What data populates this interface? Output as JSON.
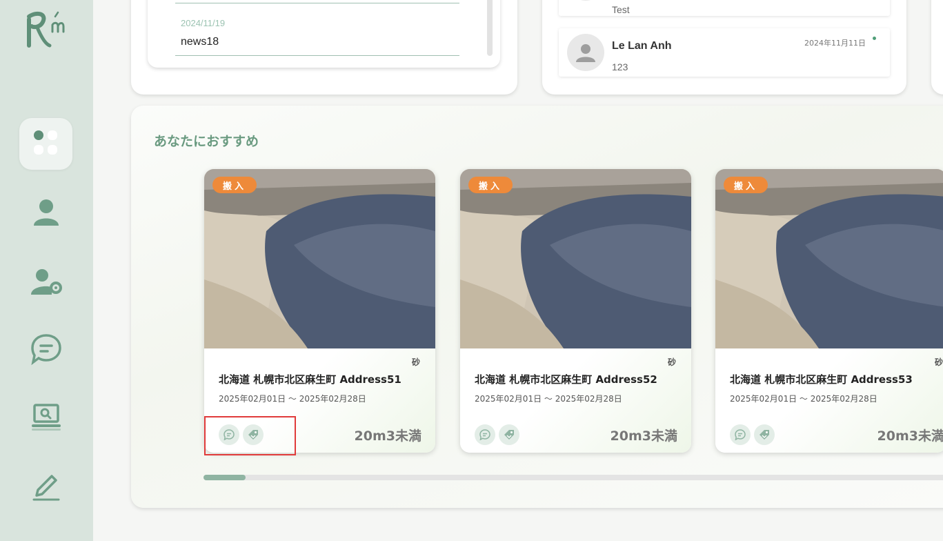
{
  "sidebar": {
    "logo": "logo-rm",
    "items": [
      {
        "name": "dashboard-icon",
        "active": true
      },
      {
        "name": "user-icon"
      },
      {
        "name": "user-settings-icon"
      },
      {
        "name": "chat-icon"
      },
      {
        "name": "laptop-search-icon"
      },
      {
        "name": "pencil-icon"
      }
    ]
  },
  "news": {
    "date": "2024/11/19",
    "title": "news18"
  },
  "messages": [
    {
      "name": "",
      "text": "Test",
      "date": ""
    },
    {
      "name": "Le Lan Anh",
      "text": "123",
      "date": "2024年11月11日",
      "unread": true
    }
  ],
  "recommend": {
    "title": "あなたにおすすめ",
    "cards": [
      {
        "badge": "搬入",
        "category": "砂",
        "title": "北海道 札幌市北区麻生町 Address51",
        "date": "2025年02月01日 〜 2025年02月28日",
        "volume": "20m3未満"
      },
      {
        "badge": "搬入",
        "category": "砂",
        "title": "北海道 札幌市北区麻生町 Address52",
        "date": "2025年02月01日 〜 2025年02月28日",
        "volume": "20m3未満"
      },
      {
        "badge": "搬入",
        "category": "砂",
        "title": "北海道 札幌市北区麻生町 Address53",
        "date": "2025年02月01日 〜 2025年02月28日",
        "volume": "20m3未満"
      }
    ]
  },
  "colors": {
    "accent": "#6a9a80",
    "badge": "#ee8a3a",
    "sidebar": "#d9e4dd",
    "highlight": "#e03a3a"
  }
}
